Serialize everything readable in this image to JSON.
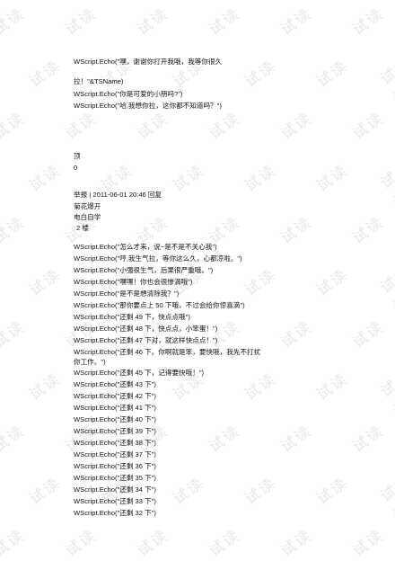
{
  "watermark": "试读",
  "block1": [
    "WScript.Echo(\"嘿，谢谢你打开我哦，我等你很久",
    "",
    "拉！\"&TSName)",
    "WScript.Echo(\"你是可爱的小朋吗?\")",
    "WScript.Echo(\"哈,我想你拉，这你都不知道吗？\")"
  ],
  "top_label": "顶",
  "top_count": "0",
  "post": {
    "meta": "举报 | 2011-06-01 20:46 回复",
    "author_line1": "菊花爆开",
    "author_line2": "电白自学",
    "floor": "2 楼"
  },
  "block2": [
    "WScript.Echo(\"怎么才来，说~是不是不关心我\")",
    "WScript.Echo(\"哼,我生气拉，等你这么久，心都凉啦。\")",
    "WScript.Echo(\"小强很生气，后果很严重哦。\")",
    "WScript.Echo(\"嘿嘿！你也会很惨滴哦\")",
    "WScript.Echo(\"是不是想清除我？\")",
    "WScript.Echo(\"那你要点上 50 下哦，不过会给你惊喜滴\")",
    "WScript.Echo(\"还剩 49 下，快点点哦\")",
    "WScript.Echo(\"还剩 48 下，快点点，小笨蛋！\")",
    "WScript.Echo(\"还剩 47 下对，就这样快点点！\")",
    "WScript.Echo(\"还剩 46 下。你啊就是笨，要快哦，我先不打扰",
    "",
    "你工作。\")",
    "WScript.Echo(\"还剩 45 下，记得要快哦！\")",
    "WScript.Echo(\"还剩 43 下\")",
    "WScript.Echo(\"还剩 42 下\")",
    "WScript.Echo(\"还剩 41 下\")",
    "WScript.Echo(\"还剩 40 下\")",
    "WScript.Echo(\"还剩 39 下\")",
    "WScript.Echo(\"还剩 38 下\")",
    "WScript.Echo(\"还剩 37 下\")",
    "WScript.Echo(\"还剩 36 下\")",
    "WScript.Echo(\"还剩 35 下\")",
    "WScript.Echo(\"还剩 34 下\")",
    "WScript.Echo(\"还剩 33 下\")",
    "WScript.Echo(\"还剩 32 下\")"
  ]
}
